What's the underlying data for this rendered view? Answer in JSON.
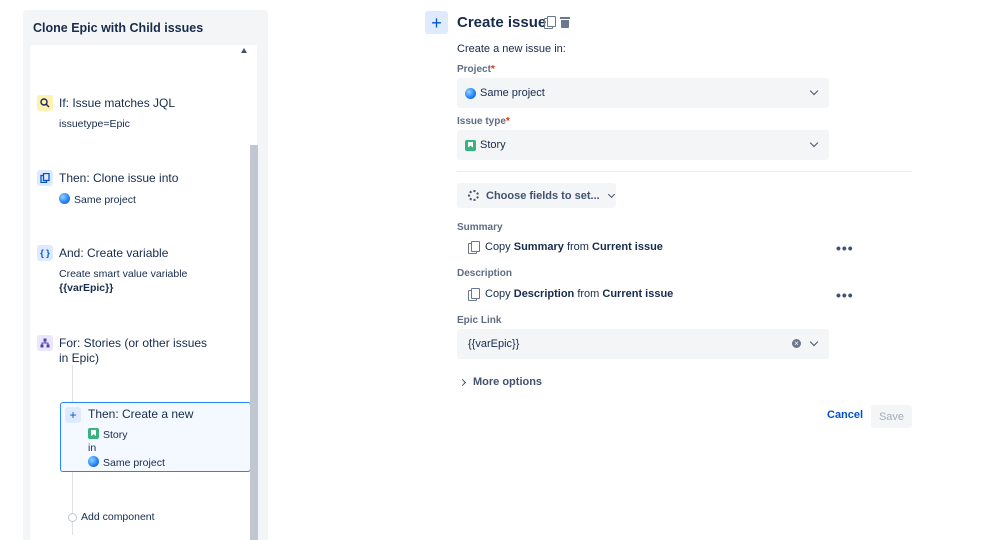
{
  "rule": {
    "title": "Clone Epic with Child issues",
    "steps": [
      {
        "title": "If: Issue matches JQL",
        "detail": "issuetype=Epic"
      },
      {
        "title": "Then: Clone issue into",
        "detail": "Same project"
      },
      {
        "title": "And: Create variable",
        "detail": "Create smart value variable",
        "detail2": "{{varEpic}}"
      },
      {
        "title": "For: Stories (or other issues",
        "title2": "in Epic)"
      },
      {
        "title": "Then: Create a new",
        "issue_type": "Story",
        "connector": "in",
        "project": "Same project"
      }
    ],
    "add_component": "Add component"
  },
  "form": {
    "title": "Create issue",
    "intro": "Create a new issue in:",
    "project_label": "Project",
    "project_value": "Same project",
    "issue_type_label": "Issue type",
    "issue_type_value": "Story",
    "required_mark": "*",
    "choose_fields": "Choose fields to set...",
    "summary_label": "Summary",
    "summary_copy": {
      "prefix": "Copy",
      "field": "Summary",
      "from": "from",
      "source": "Current issue"
    },
    "description_label": "Description",
    "description_copy": {
      "prefix": "Copy",
      "field": "Description",
      "from": "from",
      "source": "Current issue"
    },
    "epic_link_label": "Epic Link",
    "epic_link_value": "{{varEpic}}",
    "more_options": "More options",
    "cancel": "Cancel",
    "save": "Save",
    "more_glyph": "•••"
  },
  "colors": {
    "accent": "#0052cc",
    "selected_border": "#2684ff",
    "required": "#de350b",
    "story": "#36b37e"
  }
}
